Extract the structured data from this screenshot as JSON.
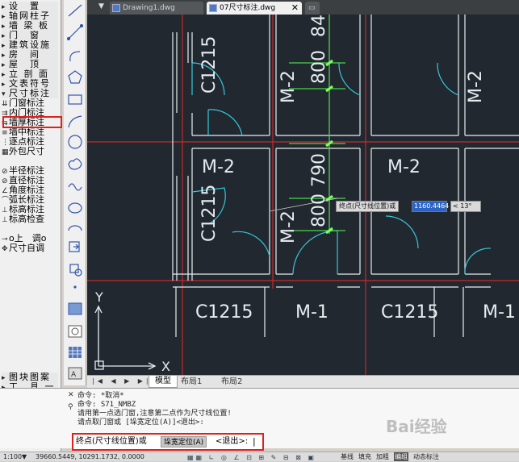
{
  "menu": {
    "items": [
      {
        "icon": "▸",
        "label": "设　置",
        "cat": true
      },
      {
        "icon": "▸",
        "label": "轴网柱子",
        "cat": true
      },
      {
        "icon": "▸",
        "label": "墙 梁 板",
        "cat": true
      },
      {
        "icon": "▸",
        "label": "门　窗",
        "cat": true
      },
      {
        "icon": "▸",
        "label": "建筑设施",
        "cat": true
      },
      {
        "icon": "▸",
        "label": "房　间",
        "cat": true
      },
      {
        "icon": "▸",
        "label": "屋　顶",
        "cat": true
      },
      {
        "icon": "▸",
        "label": "立 剖 面",
        "cat": true
      },
      {
        "icon": "▸",
        "label": "文表符号",
        "cat": true
      },
      {
        "icon": "▾",
        "label": "尺寸标注",
        "cat": true
      },
      {
        "icon": "⇊",
        "label": "门窗标注"
      },
      {
        "icon": "⇉",
        "label": "内门标注"
      },
      {
        "icon": "⇆",
        "label": "墙厚标注"
      },
      {
        "icon": "≡",
        "label": "墙中标注"
      },
      {
        "icon": "⋮",
        "label": "逐点标注"
      },
      {
        "icon": "▦",
        "label": "外包尺寸"
      },
      {
        "icon": "",
        "label": ""
      },
      {
        "icon": "⊘",
        "label": "半径标注"
      },
      {
        "icon": "⊘",
        "label": "直径标注"
      },
      {
        "icon": "∠",
        "label": "角度标注"
      },
      {
        "icon": "⌒",
        "label": "弧长标注"
      },
      {
        "icon": "⊥",
        "label": "标高标注"
      },
      {
        "icon": "⊥",
        "label": "标高检查"
      },
      {
        "icon": "",
        "label": ""
      },
      {
        "icon": "⊸",
        "label": "o上　调o"
      },
      {
        "icon": "✥",
        "label": "尺寸自调"
      }
    ],
    "bottom": [
      {
        "label": "图块图案"
      },
      {
        "label": "工　具 一"
      },
      {
        "label": "工　具 二"
      },
      {
        "label": "总图平面"
      },
      {
        "label": "文件布图"
      },
      {
        "label": "三维工具"
      },
      {
        "label": "帮　助"
      }
    ]
  },
  "tabs": [
    {
      "label": "Drawing1.dwg"
    },
    {
      "label": "07尺寸标注.dwg"
    }
  ],
  "layout_tabs": {
    "model": "模型",
    "layout1": "布局1",
    "layout2": "布局2"
  },
  "canvas": {
    "labels": {
      "c1215_a": "C1215",
      "c1215_b": "C1215",
      "c1215_bottom_a": "C1215",
      "c1215_bottom_b": "C1215",
      "m2_a": "M-2",
      "m2_b": "M-2",
      "m2_c": "M-2",
      "m2_d": "M-2",
      "m2_e": "M-2",
      "m1_a": "M-1",
      "m1_b": "M-1",
      "dim_800_top": "800",
      "dim_84": "84",
      "dim_790": "790",
      "dim_800_mid": "800"
    },
    "tooltip": {
      "prompt": "终点(尺寸线位置)或",
      "value": "1160.4464",
      "angle": "< 13°"
    },
    "ucs": {
      "x": "X",
      "y": "Y"
    }
  },
  "command": {
    "lines": [
      "命令: *取消*",
      "命令: S71_NMBZ",
      "请用第一点选门窗,注意第二点作为尺寸线位置!",
      "请点取门窗或 [垛宽定位(A)]<退出>:"
    ],
    "prompt": "终点(尺寸线位置)或",
    "option": "垛宽定位(A)",
    "exit": "<退出>:"
  },
  "status": {
    "scale": "1:100▼",
    "coords": "39660.5449, 10291.1732, 0.0000",
    "toggles": [
      "基线",
      "填充",
      "加粗",
      "编组",
      "动态标注"
    ]
  },
  "watermark": "Bai经验",
  "colors": {
    "canvas_bg": "#212830",
    "wall": "#e8eef0",
    "axis": "#d42a2a",
    "door": "#36c8d8",
    "dim": "#4ad64a",
    "highlight": "#e0201e"
  }
}
